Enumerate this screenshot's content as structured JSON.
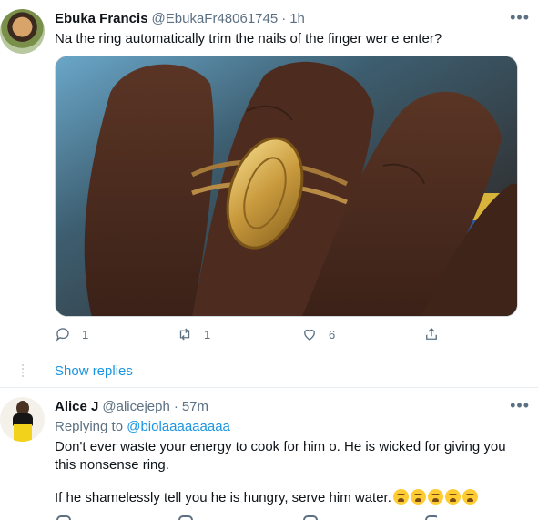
{
  "tweets": [
    {
      "name": "Ebuka Francis",
      "handle": "@EbukaFr48061745",
      "separator": "·",
      "time": "1h",
      "more": "•••",
      "text": "Na the ring automatically trim the nails of the finger wer e enter?",
      "media_icon": "photo-of-hand-with-gold-ring",
      "actions": {
        "reply_count": "1",
        "retweet_count": "1",
        "like_count": "6"
      },
      "show_replies": "Show replies"
    },
    {
      "name": "Alice J",
      "handle": "@alicejeph",
      "separator": "·",
      "time": "57m",
      "more": "•••",
      "replying_prefix": "Replying to",
      "replying_to": "@biolaaaaaaaaa",
      "text_line1": "Don't ever waste your energy to cook for him o. He is wicked for giving you this nonsense ring.",
      "text_line2": "If he shamelessly tell you he is hungry, serve him water.",
      "emoji_icon": "weary-face-icon",
      "emoji_count": 5
    }
  ],
  "colors": {
    "text": "#0f1419",
    "secondary": "#5b7083",
    "link": "#1b95e0",
    "divider": "#e6ecf0"
  }
}
